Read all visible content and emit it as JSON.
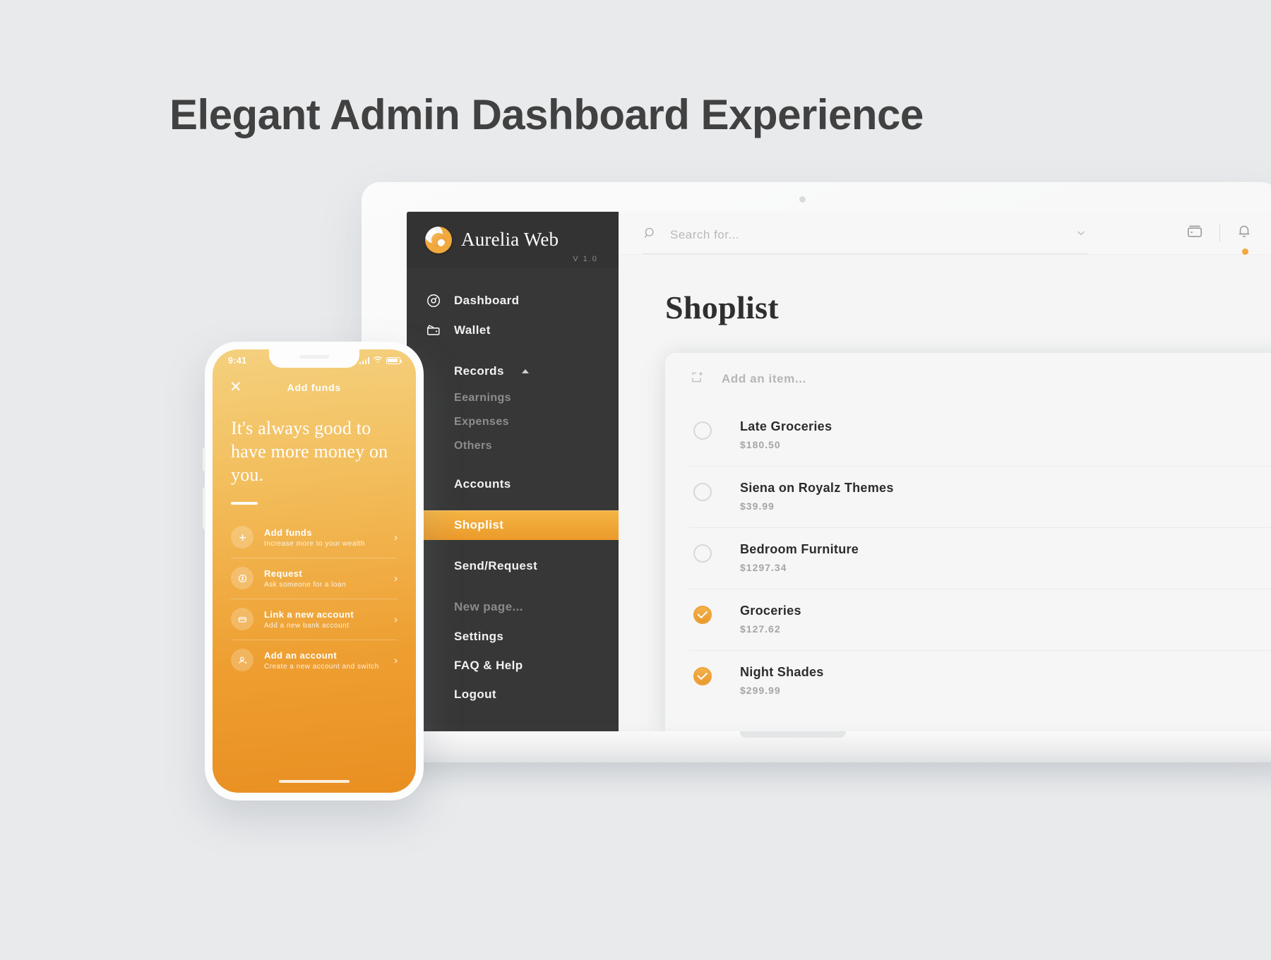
{
  "heading": "Elegant Admin Dashboard Experience",
  "colors": {
    "accent": "#eda43a",
    "sidebar_bg": "#373737",
    "page_bg": "#e8eaec",
    "title": "#414141"
  },
  "sidebar": {
    "brand": "Aurelia Web",
    "version": "V 1.0",
    "items": [
      {
        "label": "Dashboard",
        "icon": "dashboard-icon"
      },
      {
        "label": "Wallet",
        "icon": "wallet-icon"
      },
      {
        "label": "Records",
        "icon": "records-icon"
      },
      {
        "label": "Eearnings"
      },
      {
        "label": "Expenses"
      },
      {
        "label": "Others"
      },
      {
        "label": "Accounts"
      },
      {
        "label": "Shoplist"
      },
      {
        "label": "Send/Request"
      },
      {
        "label": "New page..."
      }
    ],
    "bottom_items": [
      {
        "label": "Settings"
      },
      {
        "label": "FAQ & Help"
      },
      {
        "label": "Logout"
      }
    ]
  },
  "topbar": {
    "search_placeholder": "Search for...",
    "search_value": "",
    "icons": [
      "search-icon",
      "chevron-down-icon",
      "card-icon",
      "bell-icon"
    ]
  },
  "main": {
    "title": "Shoplist",
    "add_item_placeholder": "Add an item...",
    "items": [
      {
        "name": "Late Groceries",
        "price": "$180.50",
        "checked": false
      },
      {
        "name": "Siena on Royalz Themes",
        "price": "$39.99",
        "checked": false
      },
      {
        "name": "Bedroom Furniture",
        "price": "$1297.34",
        "checked": false
      },
      {
        "name": "Groceries",
        "price": "$127.62",
        "checked": true
      },
      {
        "name": "Night Shades",
        "price": "$299.99",
        "checked": true
      }
    ]
  },
  "phone": {
    "time": "9:41",
    "screen_title": "Add funds",
    "close_label": "✕",
    "hero": "It's always good to have more money on you.",
    "rows": [
      {
        "title": "Add funds",
        "subtitle": "Increase more to your wealth",
        "icon": "plus-icon"
      },
      {
        "title": "Request",
        "subtitle": "Ask someone for a loan",
        "icon": "coin-icon"
      },
      {
        "title": "Link a new account",
        "subtitle": "Add a new bank account",
        "icon": "card-plus-icon"
      },
      {
        "title": "Add an account",
        "subtitle": "Create a new account and switch",
        "icon": "user-plus-icon"
      }
    ],
    "arrow": "›"
  }
}
